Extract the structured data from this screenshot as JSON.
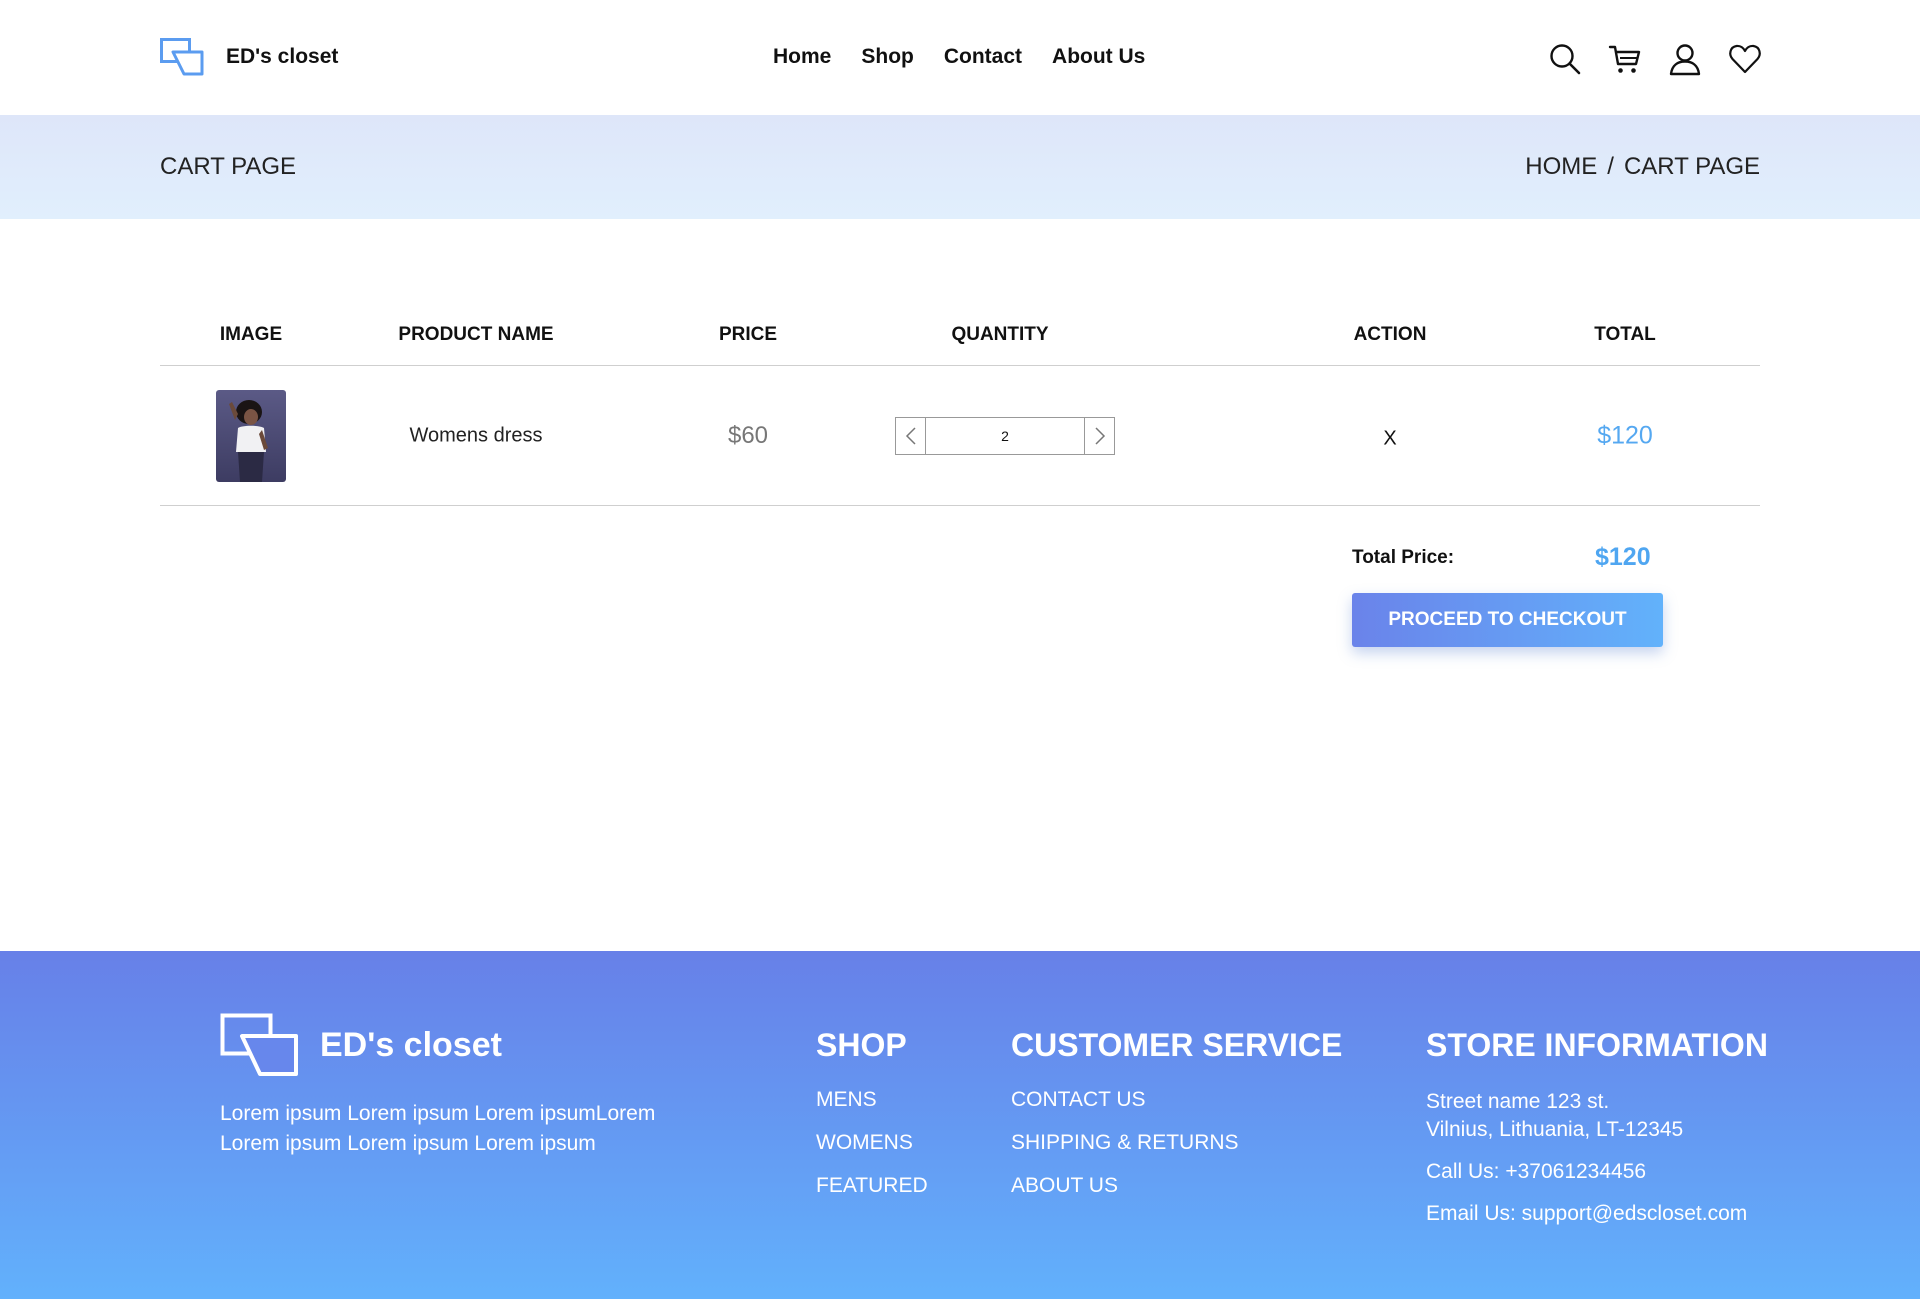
{
  "header": {
    "brand": "ED's closet",
    "nav": [
      "Home",
      "Shop",
      "Contact",
      "About Us"
    ],
    "icons": [
      "search-icon",
      "cart-icon",
      "user-icon",
      "heart-icon"
    ]
  },
  "banner": {
    "title": "CART PAGE",
    "breadcrumb": [
      "HOME",
      "/",
      "CART PAGE"
    ]
  },
  "cart": {
    "columns": [
      "IMAGE",
      "PRODUCT NAME",
      "PRICE",
      "QUANTITY",
      "ACTION",
      "TOTAL"
    ],
    "items": [
      {
        "name": "Womens dress",
        "price": "$60",
        "quantity": "2",
        "action": "X",
        "total": "$120"
      }
    ],
    "total_label": "Total Price:",
    "total_value": "$120",
    "checkout_label": "PROCEED TO CHECKOUT"
  },
  "footer": {
    "brand": "ED's closet",
    "about_lines": [
      "Lorem ipsum Lorem ipsum Lorem ipsumLorem",
      "Lorem ipsum Lorem ipsum Lorem ipsum"
    ],
    "shop": {
      "heading": "SHOP",
      "links": [
        "MENS",
        "WOMENS",
        "FEATURED"
      ]
    },
    "service": {
      "heading": "CUSTOMER SERVICE",
      "links": [
        "CONTACT US",
        "SHIPPING & RETURNS",
        "ABOUT US"
      ]
    },
    "store": {
      "heading": "STORE INFORMATION",
      "address_line1": "Street name 123 st.",
      "address_line2": "Vilnius, Lithuania, LT-12345",
      "phone": "Call Us: +37061234456",
      "email": "Email Us: support@edscloset.com"
    }
  },
  "colors": {
    "accent_blue": "#55a8f1",
    "gradient_start": "#6780e8",
    "gradient_end": "#62b1fc",
    "banner_bg": "#dee6f9"
  }
}
